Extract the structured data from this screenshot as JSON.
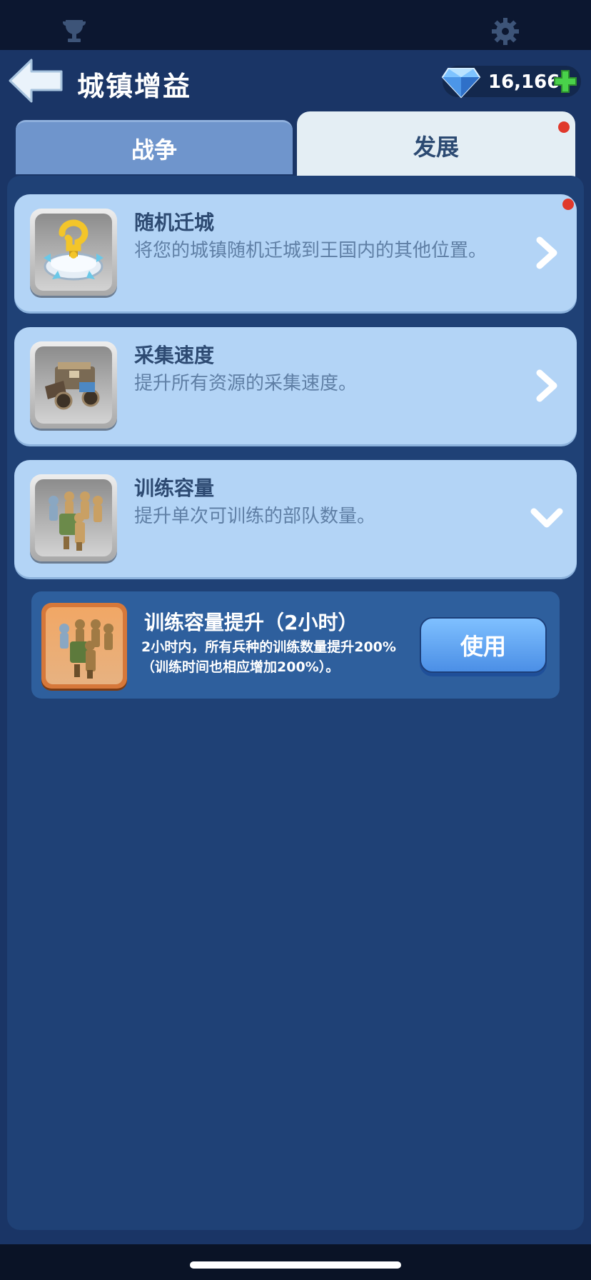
{
  "header": {
    "title": "城镇增益",
    "gems": "16,166"
  },
  "tabs": [
    {
      "label": "战争",
      "active": false
    },
    {
      "label": "发展",
      "active": true
    }
  ],
  "items": [
    {
      "title": "随机迁城",
      "desc": "将您的城镇随机迁城到王国内的其他位置。",
      "icon": "relocate-icon",
      "indicator": "chevron-right-icon"
    },
    {
      "title": "采集速度",
      "desc": "提升所有资源的采集速度。",
      "icon": "gather-cart-icon",
      "indicator": "chevron-right-icon"
    },
    {
      "title": "训练容量",
      "desc": "提升单次可训练的部队数量。",
      "icon": "troops-icon",
      "indicator": "chevron-down-icon"
    }
  ],
  "boost": {
    "title": "训练容量提升（2小时）",
    "desc_line1": "2小时内，所有兵种的训练数量提升200%",
    "desc_line2": "（训练时间也相应增加200%）。",
    "button_label": "使用"
  },
  "colors": {
    "background": "#1a3566",
    "panel": "#1f4176",
    "item_card": "#b3d4f6",
    "active_tab": "#e4eef4",
    "inactive_tab": "#6f95cc",
    "notification_dot": "#e0392c",
    "use_button": "#5fa6f5",
    "gem_plus": "#49d14a"
  }
}
